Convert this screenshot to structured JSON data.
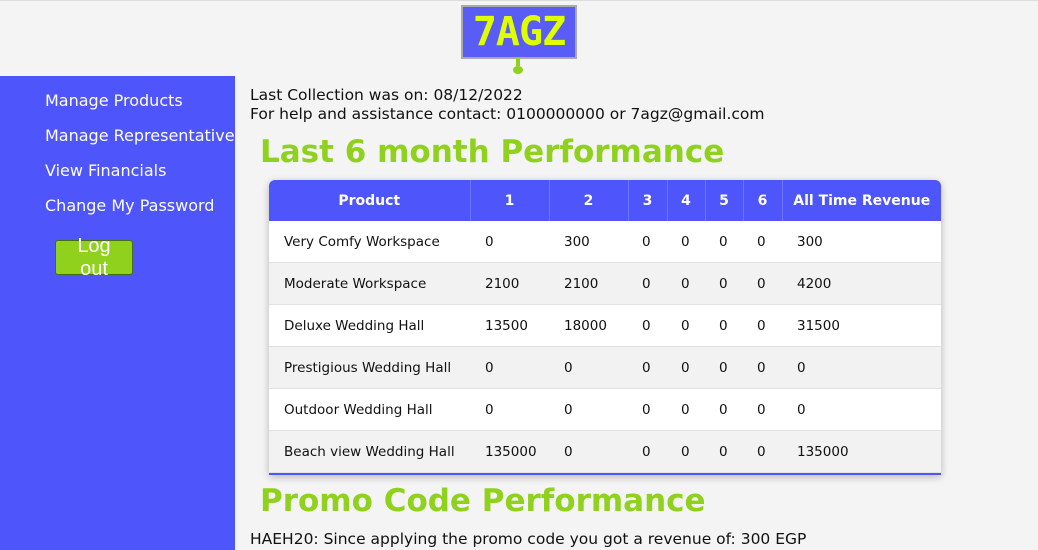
{
  "header": {
    "logo_text": "7AGZ"
  },
  "sidebar": {
    "items": [
      {
        "label": "Manage Products"
      },
      {
        "label": "Manage Representatives"
      },
      {
        "label": "View Financials"
      },
      {
        "label": "Change My Password"
      }
    ],
    "logout_label": "Log out"
  },
  "main": {
    "last_collection": "Last Collection was on: 08/12/2022",
    "help_contact": "For help and assistance contact: 0100000000 or 7agz@gmail.com",
    "performance_title": "Last 6 month Performance",
    "table": {
      "headers": [
        "Product",
        "1",
        "2",
        "3",
        "4",
        "5",
        "6",
        "All Time Revenue"
      ],
      "rows": [
        [
          "Very Comfy Workspace",
          "0",
          "300",
          "0",
          "0",
          "0",
          "0",
          "300"
        ],
        [
          "Moderate Workspace",
          "2100",
          "2100",
          "0",
          "0",
          "0",
          "0",
          "4200"
        ],
        [
          "Deluxe Wedding Hall",
          "13500",
          "18000",
          "0",
          "0",
          "0",
          "0",
          "31500"
        ],
        [
          "Prestigious Wedding Hall",
          "0",
          "0",
          "0",
          "0",
          "0",
          "0",
          "0"
        ],
        [
          "Outdoor Wedding Hall",
          "0",
          "0",
          "0",
          "0",
          "0",
          "0",
          "0"
        ],
        [
          "Beach view Wedding Hall",
          "135000",
          "0",
          "0",
          "0",
          "0",
          "0",
          "135000"
        ]
      ]
    },
    "promo_title": "Promo Code Performance",
    "promo_text": "HAEH20: Since applying the promo code you got a revenue of: 300 EGP"
  },
  "colors": {
    "accent_blue": "#4d55fb",
    "accent_green": "#8fd11c",
    "logo_text": "#dfff00"
  }
}
